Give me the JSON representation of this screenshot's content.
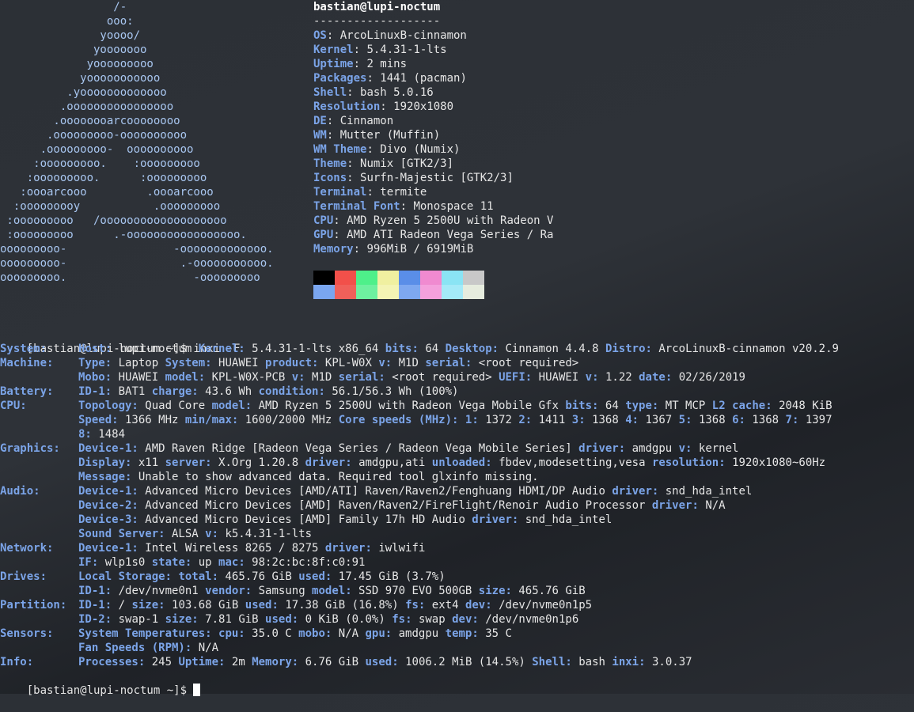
{
  "logo": [
    "                 /-",
    "                ooo:",
    "               yoooo/",
    "              yooooooo",
    "             yooooooooo",
    "            yooooooooooo",
    "          .yooooooooooooo",
    "         .oooooooooooooooo",
    "        .oooooooarcoooooooo",
    "       .ooooooooo-oooooooooo",
    "      .ooooooooo-  oooooooooo",
    "     :ooooooooo.    :ooooooooo",
    "    :ooooooooo.      :ooooooooo",
    "   :oooarcooo         .oooarcooo",
    "  :ooooooooy           .ooooooooo",
    " :ooooooooo   /ooooooooooooooooooo",
    " :ooooooooo      .-ooooooooooooooooo.",
    "ooooooooo-                -ooooooooooooo.",
    "ooooooooo-                 .-ooooooooooo.",
    "ooooooooo.                   -ooooooooo"
  ],
  "neofetch": {
    "user_host": "bastian@lupi-noctum",
    "separator": "-------------------",
    "fields": [
      {
        "k": "OS",
        "v": "ArcoLinuxB-cinnamon"
      },
      {
        "k": "Kernel",
        "v": "5.4.31-1-lts"
      },
      {
        "k": "Uptime",
        "v": "2 mins"
      },
      {
        "k": "Packages",
        "v": "1441 (pacman)"
      },
      {
        "k": "Shell",
        "v": "bash 5.0.16"
      },
      {
        "k": "Resolution",
        "v": "1920x1080"
      },
      {
        "k": "DE",
        "v": "Cinnamon"
      },
      {
        "k": "WM",
        "v": "Mutter (Muffin)"
      },
      {
        "k": "WM Theme",
        "v": "Divo (Numix)"
      },
      {
        "k": "Theme",
        "v": "Numix [GTK2/3]"
      },
      {
        "k": "Icons",
        "v": "Surfn-Majestic [GTK2/3]"
      },
      {
        "k": "Terminal",
        "v": "termite"
      },
      {
        "k": "Terminal Font",
        "v": "Monospace 11"
      },
      {
        "k": "CPU",
        "v": "AMD Ryzen 5 2500U with Radeon V"
      },
      {
        "k": "GPU",
        "v": "AMD ATI Radeon Vega Series / Ra"
      },
      {
        "k": "Memory",
        "v": "996MiB / 6919MiB"
      }
    ]
  },
  "palette": {
    "top": [
      "#000000",
      "#f2504a",
      "#4ef08a",
      "#f0f0a0",
      "#5a8ee8",
      "#f08ad0",
      "#8ae4f4",
      "#c8c8c8"
    ],
    "bottom": [
      "#7aa6f0",
      "#f0605a",
      "#6ef0a0",
      "#f4f4b4",
      "#7ea8f0",
      "#f4a0dc",
      "#a4eaf8",
      "#e6ecde"
    ]
  },
  "prompt1": "[bastian@lupi-noctum ~]$ inxi -F",
  "inxi": [
    {
      "label": "System:",
      "sub": [
        [
          [
            "k",
            "Host:"
          ],
          [
            "v",
            " lupi-noctum "
          ],
          [
            "k",
            "Kernel:"
          ],
          [
            "v",
            " 5.4.31-1-lts x86_64 "
          ],
          [
            "k",
            "bits:"
          ],
          [
            "v",
            " 64 "
          ],
          [
            "k",
            "Desktop:"
          ],
          [
            "v",
            " Cinnamon 4.4.8 "
          ],
          [
            "k",
            "Distro:"
          ],
          [
            "v",
            " ArcoLinuxB-cinnamon v20.2.9"
          ]
        ]
      ]
    },
    {
      "label": "Machine:",
      "sub": [
        [
          [
            "k",
            "Type:"
          ],
          [
            "v",
            " Laptop "
          ],
          [
            "k",
            "System:"
          ],
          [
            "v",
            " HUAWEI "
          ],
          [
            "k",
            "product:"
          ],
          [
            "v",
            " KPL-W0X "
          ],
          [
            "k",
            "v:"
          ],
          [
            "v",
            " M1D "
          ],
          [
            "k",
            "serial:"
          ],
          [
            "v",
            " <root required>"
          ]
        ],
        [
          [
            "k",
            "Mobo:"
          ],
          [
            "v",
            " HUAWEI "
          ],
          [
            "k",
            "model:"
          ],
          [
            "v",
            " KPL-W0X-PCB "
          ],
          [
            "k",
            "v:"
          ],
          [
            "v",
            " M1D "
          ],
          [
            "k",
            "serial:"
          ],
          [
            "v",
            " <root required> "
          ],
          [
            "k",
            "UEFI:"
          ],
          [
            "v",
            " HUAWEI "
          ],
          [
            "k",
            "v:"
          ],
          [
            "v",
            " 1.22 "
          ],
          [
            "k",
            "date:"
          ],
          [
            "v",
            " 02/26/2019"
          ]
        ]
      ]
    },
    {
      "label": "Battery:",
      "sub": [
        [
          [
            "k",
            "ID-1:"
          ],
          [
            "v",
            " BAT1 "
          ],
          [
            "k",
            "charge:"
          ],
          [
            "v",
            " 43.6 Wh "
          ],
          [
            "k",
            "condition:"
          ],
          [
            "v",
            " 56.1/56.3 Wh (100%)"
          ]
        ]
      ]
    },
    {
      "label": "CPU:",
      "sub": [
        [
          [
            "k",
            "Topology:"
          ],
          [
            "v",
            " Quad Core "
          ],
          [
            "k",
            "model:"
          ],
          [
            "v",
            " AMD Ryzen 5 2500U with Radeon Vega Mobile Gfx "
          ],
          [
            "k",
            "bits:"
          ],
          [
            "v",
            " 64 "
          ],
          [
            "k",
            "type:"
          ],
          [
            "v",
            " MT MCP "
          ],
          [
            "k",
            "L2 cache:"
          ],
          [
            "v",
            " 2048 KiB"
          ]
        ],
        [
          [
            "k",
            "Speed:"
          ],
          [
            "v",
            " 1366 MHz "
          ],
          [
            "k",
            "min/max:"
          ],
          [
            "v",
            " 1600/2000 MHz "
          ],
          [
            "k",
            "Core speeds (MHz):"
          ],
          [
            "v",
            " "
          ],
          [
            "k",
            "1:"
          ],
          [
            "v",
            " 1372 "
          ],
          [
            "k",
            "2:"
          ],
          [
            "v",
            " 1411 "
          ],
          [
            "k",
            "3:"
          ],
          [
            "v",
            " 1368 "
          ],
          [
            "k",
            "4:"
          ],
          [
            "v",
            " 1367 "
          ],
          [
            "k",
            "5:"
          ],
          [
            "v",
            " 1368 "
          ],
          [
            "k",
            "6:"
          ],
          [
            "v",
            " 1368 "
          ],
          [
            "k",
            "7:"
          ],
          [
            "v",
            " 1397"
          ]
        ],
        [
          [
            "k",
            "8:"
          ],
          [
            "v",
            " 1484"
          ]
        ]
      ]
    },
    {
      "label": "Graphics:",
      "sub": [
        [
          [
            "k",
            "Device-1:"
          ],
          [
            "v",
            " AMD Raven Ridge [Radeon Vega Series / Radeon Vega Mobile Series] "
          ],
          [
            "k",
            "driver:"
          ],
          [
            "v",
            " amdgpu "
          ],
          [
            "k",
            "v:"
          ],
          [
            "v",
            " kernel"
          ]
        ],
        [
          [
            "k",
            "Display:"
          ],
          [
            "v",
            " x11 "
          ],
          [
            "k",
            "server:"
          ],
          [
            "v",
            " X.Org 1.20.8 "
          ],
          [
            "k",
            "driver:"
          ],
          [
            "v",
            " amdgpu,ati "
          ],
          [
            "k",
            "unloaded:"
          ],
          [
            "v",
            " fbdev,modesetting,vesa "
          ],
          [
            "k",
            "resolution:"
          ],
          [
            "v",
            " 1920x1080~60Hz"
          ]
        ],
        [
          [
            "k",
            "Message:"
          ],
          [
            "v",
            " Unable to show advanced data. Required tool glxinfo missing."
          ]
        ]
      ]
    },
    {
      "label": "Audio:",
      "sub": [
        [
          [
            "k",
            "Device-1:"
          ],
          [
            "v",
            " Advanced Micro Devices [AMD/ATI] Raven/Raven2/Fenghuang HDMI/DP Audio "
          ],
          [
            "k",
            "driver:"
          ],
          [
            "v",
            " snd_hda_intel"
          ]
        ],
        [
          [
            "k",
            "Device-2:"
          ],
          [
            "v",
            " Advanced Micro Devices [AMD] Raven/Raven2/FireFlight/Renoir Audio Processor "
          ],
          [
            "k",
            "driver:"
          ],
          [
            "v",
            " N/A"
          ]
        ],
        [
          [
            "k",
            "Device-3:"
          ],
          [
            "v",
            " Advanced Micro Devices [AMD] Family 17h HD Audio "
          ],
          [
            "k",
            "driver:"
          ],
          [
            "v",
            " snd_hda_intel"
          ]
        ],
        [
          [
            "k",
            "Sound Server:"
          ],
          [
            "v",
            " ALSA "
          ],
          [
            "k",
            "v:"
          ],
          [
            "v",
            " k5.4.31-1-lts"
          ]
        ]
      ]
    },
    {
      "label": "Network:",
      "sub": [
        [
          [
            "k",
            "Device-1:"
          ],
          [
            "v",
            " Intel Wireless 8265 / 8275 "
          ],
          [
            "k",
            "driver:"
          ],
          [
            "v",
            " iwlwifi"
          ]
        ],
        [
          [
            "k",
            "IF:"
          ],
          [
            "v",
            " wlp1s0 "
          ],
          [
            "k",
            "state:"
          ],
          [
            "v",
            " up "
          ],
          [
            "k",
            "mac:"
          ],
          [
            "v",
            " 98:2c:bc:8f:c0:91"
          ]
        ]
      ]
    },
    {
      "label": "Drives:",
      "sub": [
        [
          [
            "k",
            "Local Storage:"
          ],
          [
            "v",
            " "
          ],
          [
            "k",
            "total:"
          ],
          [
            "v",
            " 465.76 GiB "
          ],
          [
            "k",
            "used:"
          ],
          [
            "v",
            " 17.45 GiB (3.7%)"
          ]
        ],
        [
          [
            "k",
            "ID-1:"
          ],
          [
            "v",
            " /dev/nvme0n1 "
          ],
          [
            "k",
            "vendor:"
          ],
          [
            "v",
            " Samsung "
          ],
          [
            "k",
            "model:"
          ],
          [
            "v",
            " SSD 970 EVO 500GB "
          ],
          [
            "k",
            "size:"
          ],
          [
            "v",
            " 465.76 GiB"
          ]
        ]
      ]
    },
    {
      "label": "Partition:",
      "sub": [
        [
          [
            "k",
            "ID-1:"
          ],
          [
            "v",
            " / "
          ],
          [
            "k",
            "size:"
          ],
          [
            "v",
            " 103.68 GiB "
          ],
          [
            "k",
            "used:"
          ],
          [
            "v",
            " 17.38 GiB (16.8%) "
          ],
          [
            "k",
            "fs:"
          ],
          [
            "v",
            " ext4 "
          ],
          [
            "k",
            "dev:"
          ],
          [
            "v",
            " /dev/nvme0n1p5"
          ]
        ],
        [
          [
            "k",
            "ID-2:"
          ],
          [
            "v",
            " swap-1 "
          ],
          [
            "k",
            "size:"
          ],
          [
            "v",
            " 7.81 GiB "
          ],
          [
            "k",
            "used:"
          ],
          [
            "v",
            " 0 KiB (0.0%) "
          ],
          [
            "k",
            "fs:"
          ],
          [
            "v",
            " swap "
          ],
          [
            "k",
            "dev:"
          ],
          [
            "v",
            " /dev/nvme0n1p6"
          ]
        ]
      ]
    },
    {
      "label": "Sensors:",
      "sub": [
        [
          [
            "k",
            "System Temperatures:"
          ],
          [
            "v",
            " "
          ],
          [
            "k",
            "cpu:"
          ],
          [
            "v",
            " 35.0 C "
          ],
          [
            "k",
            "mobo:"
          ],
          [
            "v",
            " N/A "
          ],
          [
            "k",
            "gpu:"
          ],
          [
            "v",
            " amdgpu "
          ],
          [
            "k",
            "temp:"
          ],
          [
            "v",
            " 35 C"
          ]
        ],
        [
          [
            "k",
            "Fan Speeds (RPM):"
          ],
          [
            "v",
            " N/A"
          ]
        ]
      ]
    },
    {
      "label": "Info:",
      "sub": [
        [
          [
            "k",
            "Processes:"
          ],
          [
            "v",
            " 245 "
          ],
          [
            "k",
            "Uptime:"
          ],
          [
            "v",
            " 2m "
          ],
          [
            "k",
            "Memory:"
          ],
          [
            "v",
            " 6.76 GiB "
          ],
          [
            "k",
            "used:"
          ],
          [
            "v",
            " 1006.2 MiB (14.5%) "
          ],
          [
            "k",
            "Shell:"
          ],
          [
            "v",
            " bash "
          ],
          [
            "k",
            "inxi:"
          ],
          [
            "v",
            " 3.0.37"
          ]
        ]
      ]
    }
  ],
  "prompt2": "[bastian@lupi-noctum ~]$ "
}
